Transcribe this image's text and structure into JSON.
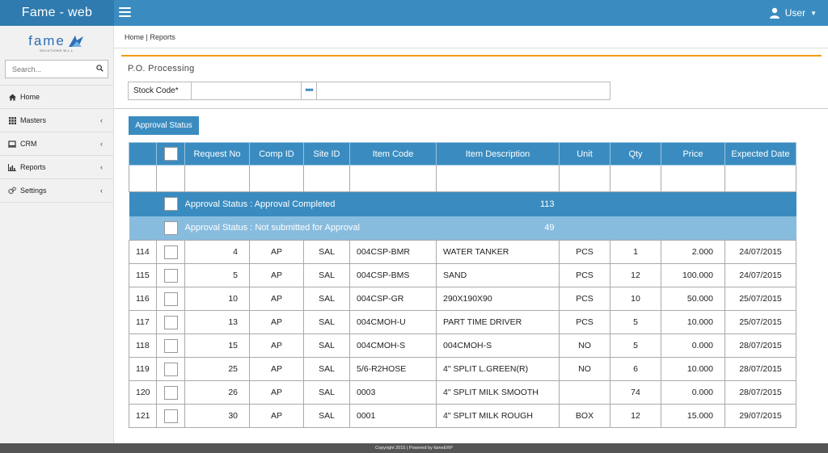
{
  "app": {
    "title": "Fame - web"
  },
  "user": {
    "label": "User"
  },
  "logo": {
    "text": "fame",
    "sub": "SOLUTIONS W.L.L"
  },
  "search": {
    "placeholder": "Search..."
  },
  "nav": [
    {
      "label": "Home",
      "icon": "home-icon"
    },
    {
      "label": "Masters",
      "icon": "grid-icon"
    },
    {
      "label": "CRM",
      "icon": "monitor-icon"
    },
    {
      "label": "Reports",
      "icon": "bar-chart-icon"
    },
    {
      "label": "Settings",
      "icon": "gears-icon"
    }
  ],
  "breadcrumb": "Home | Reports",
  "panel": {
    "title": "P.O. Processing"
  },
  "stock": {
    "label": "Stock Code*",
    "dots": "•••"
  },
  "approval_button": "Approval Status",
  "table": {
    "headers": [
      "",
      "",
      "Request No",
      "Comp ID",
      "Site ID",
      "Item Code",
      "Item Description",
      "Unit",
      "Qty",
      "Price",
      "Expected Date"
    ],
    "groups": [
      {
        "label": "Approval Status : Approval Completed",
        "count": "113"
      },
      {
        "label": "Approval Status : Not submitted for Approval",
        "count": "49"
      }
    ],
    "rows": [
      {
        "id": "114",
        "req": "4",
        "comp": "AP",
        "site": "SAL",
        "code": "004CSP-BMR",
        "desc": "WATER TANKER",
        "unit": "PCS",
        "qty": "1",
        "price": "2.000",
        "date": "24/07/2015"
      },
      {
        "id": "115",
        "req": "5",
        "comp": "AP",
        "site": "SAL",
        "code": "004CSP-BMS",
        "desc": "SAND",
        "unit": "PCS",
        "qty": "12",
        "price": "100.000",
        "date": "24/07/2015"
      },
      {
        "id": "116",
        "req": "10",
        "comp": "AP",
        "site": "SAL",
        "code": "004CSP-GR",
        "desc": "290X190X90",
        "unit": "PCS",
        "qty": "10",
        "price": "50.000",
        "date": "25/07/2015"
      },
      {
        "id": "117",
        "req": "13",
        "comp": "AP",
        "site": "SAL",
        "code": "004CMOH-U",
        "desc": "PART TIME DRIVER",
        "unit": "PCS",
        "qty": "5",
        "price": "10.000",
        "date": "25/07/2015"
      },
      {
        "id": "118",
        "req": "15",
        "comp": "AP",
        "site": "SAL",
        "code": "004CMOH-S",
        "desc": "004CMOH-S",
        "unit": "NO",
        "qty": "5",
        "price": "0.000",
        "date": "28/07/2015"
      },
      {
        "id": "119",
        "req": "25",
        "comp": "AP",
        "site": "SAL",
        "code": "5/6-R2HOSE",
        "desc": "4\" SPLIT L.GREEN(R)",
        "unit": "NO",
        "qty": "6",
        "price": "10.000",
        "date": "28/07/2015"
      },
      {
        "id": "120",
        "req": "26",
        "comp": "AP",
        "site": "SAL",
        "code": "0003",
        "desc": "4\" SPLIT MILK SMOOTH",
        "unit": "",
        "qty": "74",
        "price": "0.000",
        "date": "28/07/2015"
      },
      {
        "id": "121",
        "req": "30",
        "comp": "AP",
        "site": "SAL",
        "code": "0001",
        "desc": "4\" SPLIT MILK ROUGH",
        "unit": "BOX",
        "qty": "12",
        "price": "15.000",
        "date": "29/07/2015"
      }
    ]
  },
  "footer": "Copyright 2015 | Powered by fameERP",
  "colors": {
    "primary": "#3a8cc0",
    "accent": "#f39c12",
    "group_light": "#88bcde"
  }
}
